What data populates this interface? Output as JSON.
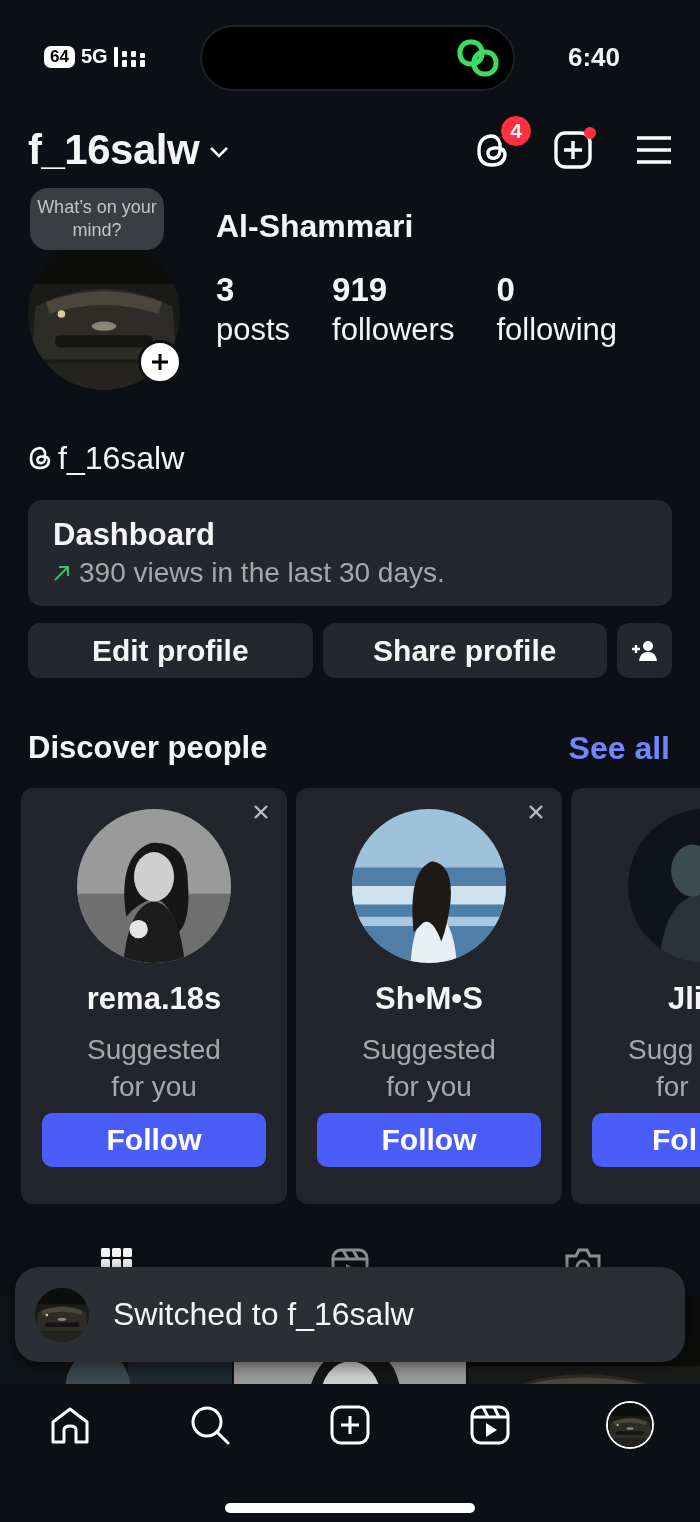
{
  "status_bar": {
    "battery": "64",
    "network": "5G",
    "time": "6:40"
  },
  "header": {
    "username": "f_16salw",
    "threads_badge": "4",
    "create_has_dot": true
  },
  "profile": {
    "note": "What’s on your mind?",
    "display_name": "Al-Shammari",
    "stats": [
      {
        "value": "3",
        "label": "posts"
      },
      {
        "value": "919",
        "label": "followers"
      },
      {
        "value": "0",
        "label": "following"
      }
    ],
    "threads_handle": "f_16salw"
  },
  "dashboard": {
    "title": "Dashboard",
    "summary": "390 views in the last 30 days."
  },
  "actions": [
    "Edit profile",
    "Share profile"
  ],
  "discover": {
    "title": "Discover people",
    "link": "See all",
    "cards": [
      {
        "kind": "full",
        "name": "rema.18s",
        "subtitle_lines": [
          "Suggested",
          "for you"
        ],
        "button": "Follow"
      },
      {
        "kind": "full",
        "name": "Sh•M•S",
        "subtitle_lines": [
          "Suggested",
          "for you"
        ],
        "button": "Follow"
      },
      {
        "kind": "cut",
        "name": "Jli",
        "subtitle_lines": [
          "Sugg",
          "for"
        ],
        "button": "Fol"
      }
    ]
  },
  "profile_tabs": [
    {
      "kind": "grid",
      "selected": true
    },
    {
      "kind": "reels",
      "selected": false
    },
    {
      "kind": "tagged",
      "selected": false
    }
  ],
  "toast": {
    "text": "Switched to f_16salw"
  },
  "nav": [
    {
      "kind": "home",
      "selected": false
    },
    {
      "kind": "search",
      "selected": false
    },
    {
      "kind": "create",
      "selected": false
    },
    {
      "kind": "reels",
      "selected": false
    },
    {
      "kind": "profile",
      "selected": true
    }
  ]
}
